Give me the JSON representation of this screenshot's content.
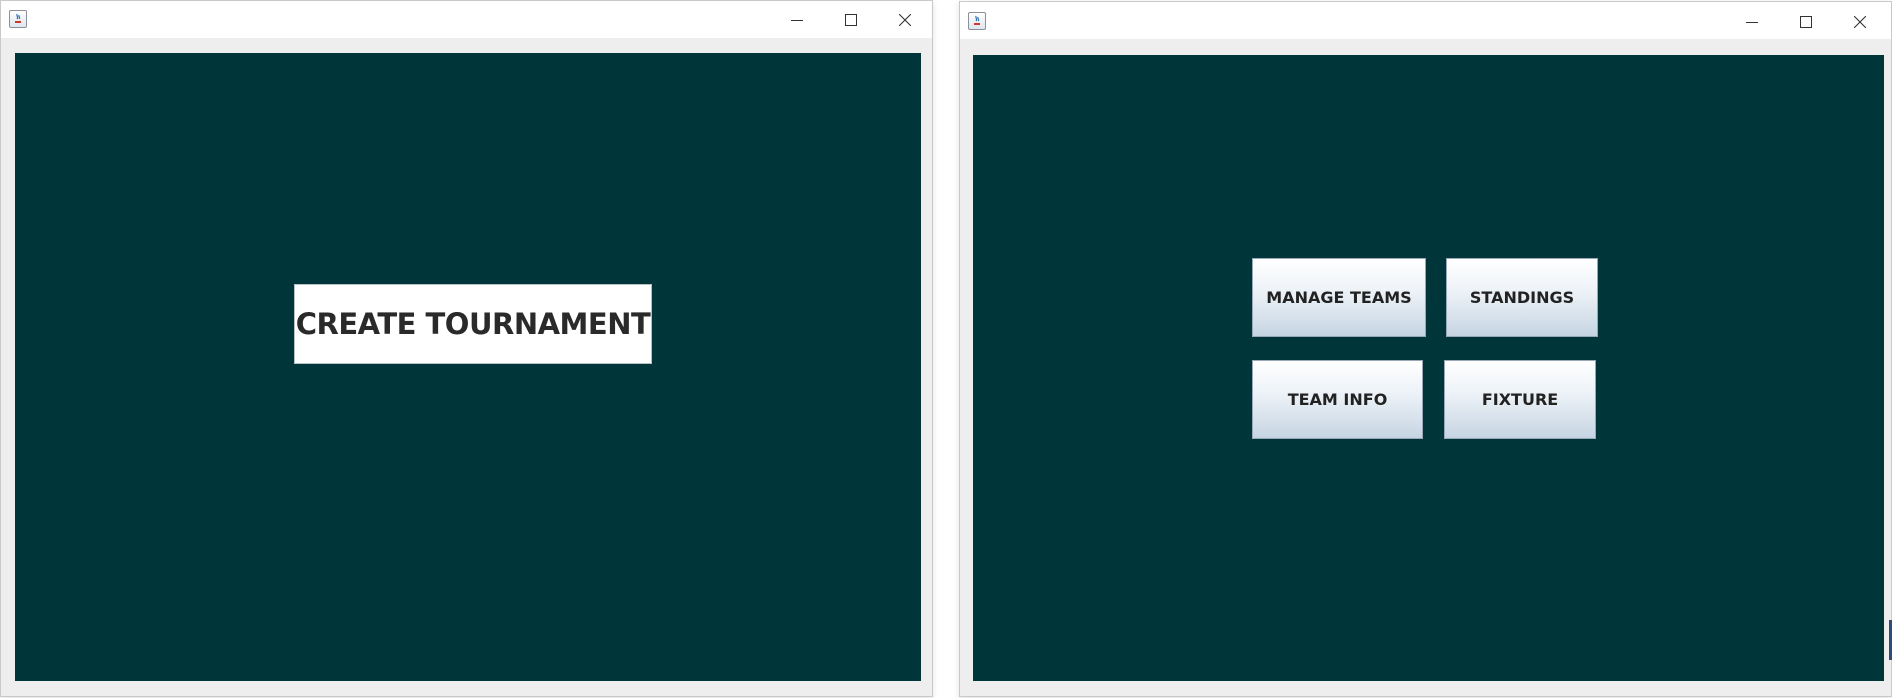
{
  "window_left": {
    "title": "",
    "create_button": "CREATE TOURNAMENT"
  },
  "window_right": {
    "title": "",
    "buttons": {
      "manage_teams": "MANAGE TEAMS",
      "standings": "STANDINGS",
      "team_info": "TEAM INFO",
      "fixture": "FIXTURE"
    }
  },
  "colors": {
    "content_background": "#00353a",
    "window_frame": "#eeeeee",
    "titlebar": "#ffffff"
  },
  "icons": [
    "java-app-icon",
    "minimize-icon",
    "maximize-icon",
    "close-icon"
  ]
}
